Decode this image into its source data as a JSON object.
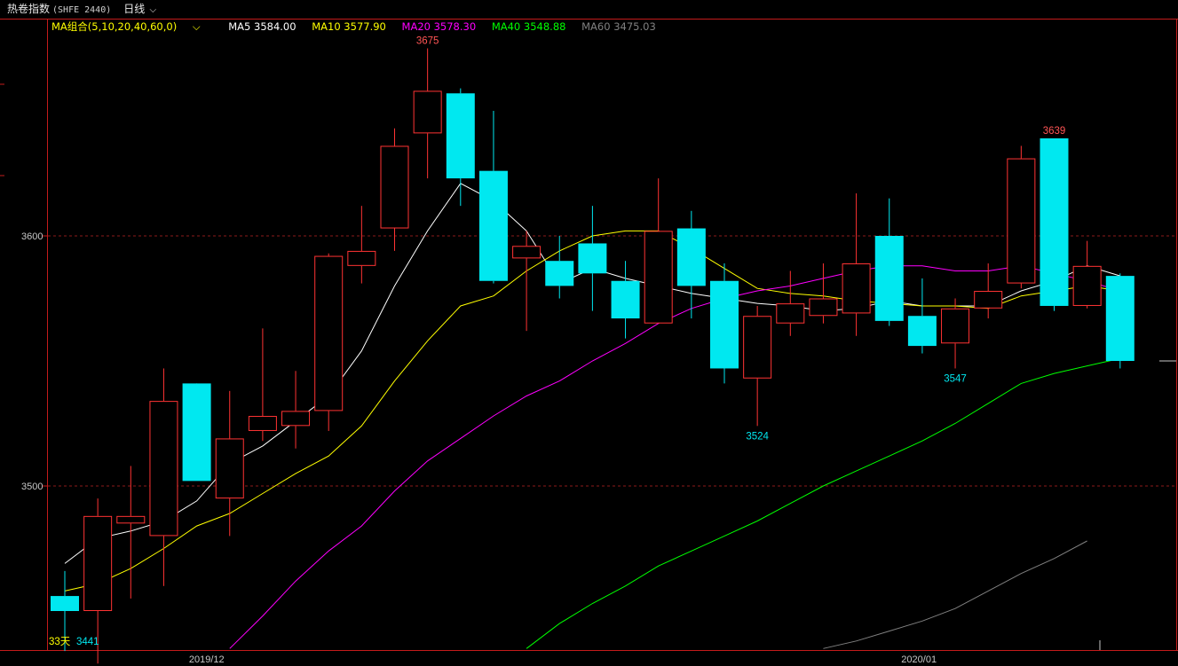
{
  "header": {
    "symbol": "热卷指数",
    "code": "(SHFE 2440)",
    "period": "日线"
  },
  "legend": {
    "group_label": "MA组合(5,10,20,40,60,0)",
    "items": [
      {
        "label": "MA5 3584.00",
        "color": "#ffffff"
      },
      {
        "label": "MA10 3577.90",
        "color": "#ffff00"
      },
      {
        "label": "MA20 3578.30",
        "color": "#ff00ff"
      },
      {
        "label": "MA40 3548.88",
        "color": "#00ff00"
      },
      {
        "label": "MA60 3475.03",
        "color": "#808080"
      }
    ]
  },
  "colors": {
    "up": "#ff3333",
    "down": "#00e8f0",
    "grid": "#8b1a1a",
    "frame": "#c41b1b",
    "axis_text": "#c8c8c8",
    "group_label": "#ffff00"
  },
  "chart_data": {
    "type": "candlestick",
    "y_ticks": [
      {
        "value": 3600,
        "label": "3600"
      },
      {
        "value": 3500,
        "label": "3500"
      }
    ],
    "x_ticks": [
      {
        "index": 4.3,
        "label": "2019/12"
      },
      {
        "index": 25.9,
        "label": "2020/01"
      }
    ],
    "ylim": [
      3435,
      3675
    ],
    "grid_lines": [
      3600,
      3500
    ],
    "candles": [
      {
        "o": 3456,
        "c": 3450,
        "h": 3466,
        "l": 3434
      },
      {
        "o": 3450,
        "c": 3488,
        "h": 3495,
        "l": 3429
      },
      {
        "o": 3485,
        "c": 3488,
        "h": 3508,
        "l": 3455
      },
      {
        "o": 3480,
        "c": 3534,
        "h": 3547,
        "l": 3460
      },
      {
        "o": 3541,
        "c": 3502,
        "h": 3540,
        "l": 3502
      },
      {
        "o": 3495,
        "c": 3519,
        "h": 3538,
        "l": 3480
      },
      {
        "o": 3522,
        "c": 3528,
        "h": 3563,
        "l": 3518
      },
      {
        "o": 3524,
        "c": 3530,
        "h": 3546,
        "l": 3515
      },
      {
        "o": 3530,
        "c": 3592,
        "h": 3593,
        "l": 3522
      },
      {
        "o": 3588,
        "c": 3594,
        "h": 3612,
        "l": 3581
      },
      {
        "o": 3603,
        "c": 3636,
        "h": 3643,
        "l": 3594
      },
      {
        "o": 3641,
        "c": 3658,
        "h": 3675,
        "l": 3623
      },
      {
        "o": 3657,
        "c": 3623,
        "h": 3659,
        "l": 3612
      },
      {
        "o": 3626,
        "c": 3582,
        "h": 3650,
        "l": 3581
      },
      {
        "o": 3591,
        "c": 3596,
        "h": 3602,
        "l": 3562
      },
      {
        "o": 3590,
        "c": 3580,
        "h": 3600,
        "l": 3575
      },
      {
        "o": 3597,
        "c": 3585,
        "h": 3612,
        "l": 3570
      },
      {
        "o": 3582,
        "c": 3567,
        "h": 3590,
        "l": 3559
      },
      {
        "o": 3565,
        "c": 3602,
        "h": 3623,
        "l": 3565
      },
      {
        "o": 3603,
        "c": 3580,
        "h": 3610,
        "l": 3567
      },
      {
        "o": 3582,
        "c": 3547,
        "h": 3589,
        "l": 3541
      },
      {
        "o": 3543,
        "c": 3568,
        "h": 3572,
        "l": 3524
      },
      {
        "o": 3565,
        "c": 3573,
        "h": 3586,
        "l": 3560
      },
      {
        "o": 3568,
        "c": 3575,
        "h": 3589,
        "l": 3565
      },
      {
        "o": 3569,
        "c": 3589,
        "h": 3617,
        "l": 3560
      },
      {
        "o": 3600,
        "c": 3566,
        "h": 3615,
        "l": 3564
      },
      {
        "o": 3568,
        "c": 3556,
        "h": 3583,
        "l": 3553
      },
      {
        "o": 3557,
        "c": 3571,
        "h": 3575,
        "l": 3547
      },
      {
        "o": 3571,
        "c": 3578,
        "h": 3589,
        "l": 3567
      },
      {
        "o": 3581,
        "c": 3631,
        "h": 3636,
        "l": 3579
      },
      {
        "o": 3639,
        "c": 3572,
        "h": 3639,
        "l": 3570
      },
      {
        "o": 3572,
        "c": 3588,
        "h": 3598,
        "l": 3571
      },
      {
        "o": 3584,
        "c": 3550,
        "h": 3585,
        "l": 3547
      }
    ],
    "series": [
      {
        "name": "MA5",
        "color": "#ffffff",
        "start": 0,
        "values": [
          3469,
          3479,
          3482,
          3486,
          3494,
          3509,
          3516,
          3526,
          3536,
          3554,
          3580,
          3602,
          3621,
          3614,
          3602,
          3581,
          3587,
          3583,
          3580,
          3577,
          3575,
          3573,
          3572,
          3570,
          3571,
          3574,
          3572,
          3572,
          3572,
          3578,
          3582,
          3588,
          3584
        ]
      },
      {
        "name": "MA10",
        "color": "#ffff00",
        "start": 0,
        "values": [
          3458,
          3461,
          3467,
          3475,
          3484,
          3489,
          3497,
          3505,
          3512,
          3524,
          3542,
          3558,
          3572,
          3576,
          3586,
          3594,
          3600,
          3602,
          3602,
          3595,
          3587,
          3579,
          3577,
          3576,
          3574,
          3573,
          3572,
          3572,
          3571,
          3576,
          3578,
          3580,
          3578
        ]
      },
      {
        "name": "MA20",
        "color": "#ff00ff",
        "start": 5,
        "values": [
          3435,
          3448,
          3462,
          3474,
          3484,
          3498,
          3510,
          3519,
          3528,
          3536,
          3542,
          3550,
          3557,
          3565,
          3571,
          3575,
          3578,
          3580,
          3583,
          3586,
          3588,
          3588,
          3586,
          3586,
          3588,
          3585,
          3582,
          3578
        ]
      },
      {
        "name": "MA40",
        "color": "#00ff00",
        "start": 14,
        "values": [
          3435,
          3445,
          3453,
          3460,
          3468,
          3474,
          3480,
          3486,
          3493,
          3500,
          3506,
          3512,
          3518,
          3525,
          3533,
          3541,
          3545,
          3548,
          3551
        ]
      },
      {
        "name": "MA60",
        "color": "#808080",
        "start": 23,
        "values": [
          3435,
          3438,
          3442,
          3446,
          3451,
          3458,
          3465,
          3471,
          3478
        ]
      }
    ],
    "annotations": [
      {
        "index": 11,
        "value": 3675,
        "label": "3675",
        "pos": "above",
        "color": "#ff5555"
      },
      {
        "index": 21,
        "value": 3524,
        "label": "3524",
        "pos": "below",
        "color": "#00e8f0"
      },
      {
        "index": 27,
        "value": 3547,
        "label": "3547",
        "pos": "below",
        "color": "#00e8f0"
      },
      {
        "index": 30,
        "value": 3639,
        "label": "3639",
        "pos": "above",
        "color": "#ff5555"
      }
    ],
    "bottom_left": {
      "days": "33天",
      "low_label": "3441"
    }
  }
}
